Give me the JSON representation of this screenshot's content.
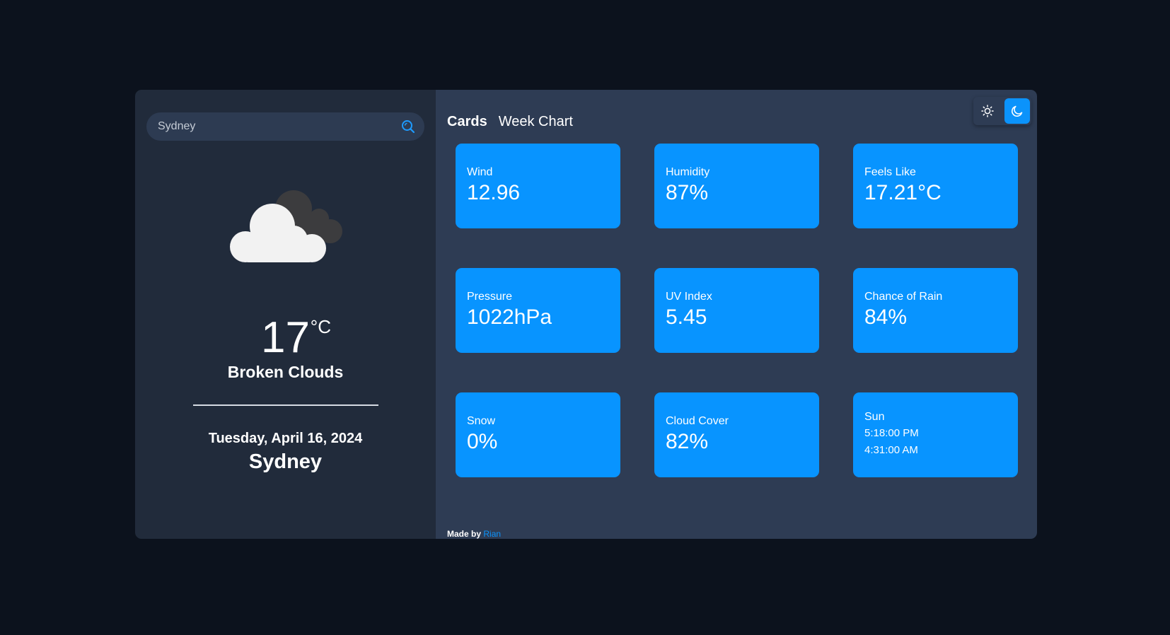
{
  "search": {
    "value": "Sydney"
  },
  "current": {
    "temperature": "17",
    "unit": "°C",
    "condition": "Broken Clouds",
    "date": "Tuesday, April 16, 2024",
    "city": "Sydney"
  },
  "tabs": [
    {
      "label": "Cards",
      "active": true
    },
    {
      "label": "Week Chart",
      "active": false
    }
  ],
  "cards": {
    "wind": {
      "label": "Wind",
      "value": "12.96"
    },
    "humidity": {
      "label": "Humidity",
      "value": "87%"
    },
    "feels_like": {
      "label": "Feels Like",
      "value": "17.21°C"
    },
    "pressure": {
      "label": "Pressure",
      "value": "1022hPa"
    },
    "uv_index": {
      "label": "UV Index",
      "value": "5.45"
    },
    "chance_of_rain": {
      "label": "Chance of Rain",
      "value": "84%"
    },
    "snow": {
      "label": "Snow",
      "value": "0%"
    },
    "cloud_cover": {
      "label": "Cloud Cover",
      "value": "82%"
    },
    "sun": {
      "label": "Sun",
      "sunset": "5:18:00 PM",
      "sunrise": "4:31:00 AM"
    }
  },
  "footer": {
    "prefix": "Made by",
    "author": "Rian"
  },
  "theme": {
    "active": "dark"
  },
  "colors": {
    "accent": "#0894ff",
    "background": "#0c121d"
  }
}
